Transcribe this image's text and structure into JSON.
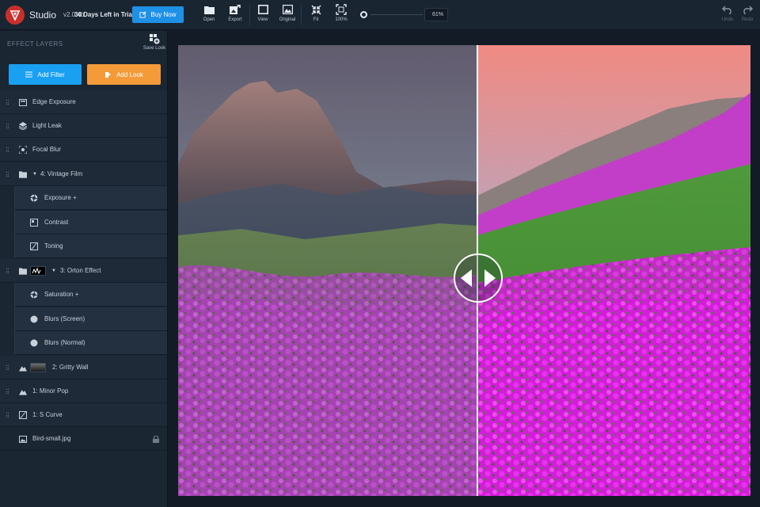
{
  "app": {
    "name": "Studio",
    "version": "v2.0.4b,",
    "trial": "30 Days Left in Trial",
    "buy_label": "Buy Now"
  },
  "toolbar": {
    "open": "Open",
    "export": "Export",
    "view": "View",
    "original": "Original",
    "fit": "Fit",
    "zoom100": "100%",
    "zoom_value": "61%",
    "undo": "Undo",
    "redo": "Redo"
  },
  "sidebar": {
    "title": "EFFECT LAYERS",
    "save_look": "Save Look",
    "add_filter": "Add Filter",
    "add_look": "Add Look",
    "layers": [
      {
        "label": "Edge Exposure",
        "icon": "edge-exposure-icon"
      },
      {
        "label": "Light Leak",
        "icon": "layers-icon"
      },
      {
        "label": "Focal Blur",
        "icon": "focus-icon"
      },
      {
        "label": "4: Vintage Film",
        "icon": "folder-icon"
      },
      {
        "label": "Exposure +",
        "icon": "aperture-icon"
      },
      {
        "label": "Contrast",
        "icon": "contrast-icon"
      },
      {
        "label": "Toning",
        "icon": "curve-icon"
      },
      {
        "label": "3: Orton Effect",
        "icon": "folder-icon"
      },
      {
        "label": "Saturation +",
        "icon": "aperture-icon"
      },
      {
        "label": "Blurs (Screen)",
        "icon": "circle-icon"
      },
      {
        "label": "Blurs (Normal)",
        "icon": "circle-icon"
      },
      {
        "label": "2: Gritty Wall",
        "icon": "mountain-icon"
      },
      {
        "label": "1: Minor Pop",
        "icon": "mountain-icon"
      },
      {
        "label": "1: S Curve",
        "icon": "curve-icon"
      },
      {
        "label": "Bird-small.jpg",
        "icon": "image-icon"
      }
    ]
  },
  "colors": {
    "accent_blue": "#1aa0f2",
    "accent_orange": "#f59a38",
    "brand_red": "#c9302c"
  }
}
